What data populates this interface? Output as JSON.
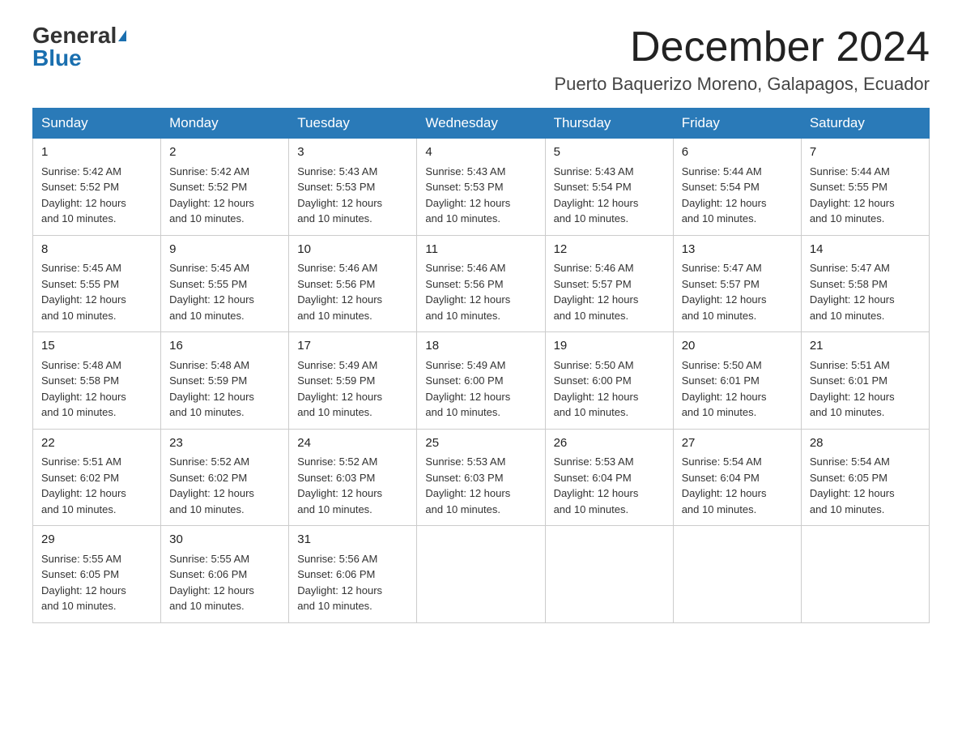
{
  "header": {
    "logo_general": "General",
    "logo_blue": "Blue",
    "month_title": "December 2024",
    "location": "Puerto Baquerizo Moreno, Galapagos, Ecuador"
  },
  "weekdays": [
    "Sunday",
    "Monday",
    "Tuesday",
    "Wednesday",
    "Thursday",
    "Friday",
    "Saturday"
  ],
  "weeks": [
    [
      {
        "day": "1",
        "sunrise": "5:42 AM",
        "sunset": "5:52 PM",
        "daylight": "12 hours and 10 minutes."
      },
      {
        "day": "2",
        "sunrise": "5:42 AM",
        "sunset": "5:52 PM",
        "daylight": "12 hours and 10 minutes."
      },
      {
        "day": "3",
        "sunrise": "5:43 AM",
        "sunset": "5:53 PM",
        "daylight": "12 hours and 10 minutes."
      },
      {
        "day": "4",
        "sunrise": "5:43 AM",
        "sunset": "5:53 PM",
        "daylight": "12 hours and 10 minutes."
      },
      {
        "day": "5",
        "sunrise": "5:43 AM",
        "sunset": "5:54 PM",
        "daylight": "12 hours and 10 minutes."
      },
      {
        "day": "6",
        "sunrise": "5:44 AM",
        "sunset": "5:54 PM",
        "daylight": "12 hours and 10 minutes."
      },
      {
        "day": "7",
        "sunrise": "5:44 AM",
        "sunset": "5:55 PM",
        "daylight": "12 hours and 10 minutes."
      }
    ],
    [
      {
        "day": "8",
        "sunrise": "5:45 AM",
        "sunset": "5:55 PM",
        "daylight": "12 hours and 10 minutes."
      },
      {
        "day": "9",
        "sunrise": "5:45 AM",
        "sunset": "5:55 PM",
        "daylight": "12 hours and 10 minutes."
      },
      {
        "day": "10",
        "sunrise": "5:46 AM",
        "sunset": "5:56 PM",
        "daylight": "12 hours and 10 minutes."
      },
      {
        "day": "11",
        "sunrise": "5:46 AM",
        "sunset": "5:56 PM",
        "daylight": "12 hours and 10 minutes."
      },
      {
        "day": "12",
        "sunrise": "5:46 AM",
        "sunset": "5:57 PM",
        "daylight": "12 hours and 10 minutes."
      },
      {
        "day": "13",
        "sunrise": "5:47 AM",
        "sunset": "5:57 PM",
        "daylight": "12 hours and 10 minutes."
      },
      {
        "day": "14",
        "sunrise": "5:47 AM",
        "sunset": "5:58 PM",
        "daylight": "12 hours and 10 minutes."
      }
    ],
    [
      {
        "day": "15",
        "sunrise": "5:48 AM",
        "sunset": "5:58 PM",
        "daylight": "12 hours and 10 minutes."
      },
      {
        "day": "16",
        "sunrise": "5:48 AM",
        "sunset": "5:59 PM",
        "daylight": "12 hours and 10 minutes."
      },
      {
        "day": "17",
        "sunrise": "5:49 AM",
        "sunset": "5:59 PM",
        "daylight": "12 hours and 10 minutes."
      },
      {
        "day": "18",
        "sunrise": "5:49 AM",
        "sunset": "6:00 PM",
        "daylight": "12 hours and 10 minutes."
      },
      {
        "day": "19",
        "sunrise": "5:50 AM",
        "sunset": "6:00 PM",
        "daylight": "12 hours and 10 minutes."
      },
      {
        "day": "20",
        "sunrise": "5:50 AM",
        "sunset": "6:01 PM",
        "daylight": "12 hours and 10 minutes."
      },
      {
        "day": "21",
        "sunrise": "5:51 AM",
        "sunset": "6:01 PM",
        "daylight": "12 hours and 10 minutes."
      }
    ],
    [
      {
        "day": "22",
        "sunrise": "5:51 AM",
        "sunset": "6:02 PM",
        "daylight": "12 hours and 10 minutes."
      },
      {
        "day": "23",
        "sunrise": "5:52 AM",
        "sunset": "6:02 PM",
        "daylight": "12 hours and 10 minutes."
      },
      {
        "day": "24",
        "sunrise": "5:52 AM",
        "sunset": "6:03 PM",
        "daylight": "12 hours and 10 minutes."
      },
      {
        "day": "25",
        "sunrise": "5:53 AM",
        "sunset": "6:03 PM",
        "daylight": "12 hours and 10 minutes."
      },
      {
        "day": "26",
        "sunrise": "5:53 AM",
        "sunset": "6:04 PM",
        "daylight": "12 hours and 10 minutes."
      },
      {
        "day": "27",
        "sunrise": "5:54 AM",
        "sunset": "6:04 PM",
        "daylight": "12 hours and 10 minutes."
      },
      {
        "day": "28",
        "sunrise": "5:54 AM",
        "sunset": "6:05 PM",
        "daylight": "12 hours and 10 minutes."
      }
    ],
    [
      {
        "day": "29",
        "sunrise": "5:55 AM",
        "sunset": "6:05 PM",
        "daylight": "12 hours and 10 minutes."
      },
      {
        "day": "30",
        "sunrise": "5:55 AM",
        "sunset": "6:06 PM",
        "daylight": "12 hours and 10 minutes."
      },
      {
        "day": "31",
        "sunrise": "5:56 AM",
        "sunset": "6:06 PM",
        "daylight": "12 hours and 10 minutes."
      },
      null,
      null,
      null,
      null
    ]
  ],
  "labels": {
    "sunrise": "Sunrise:",
    "sunset": "Sunset:",
    "daylight": "Daylight:"
  }
}
